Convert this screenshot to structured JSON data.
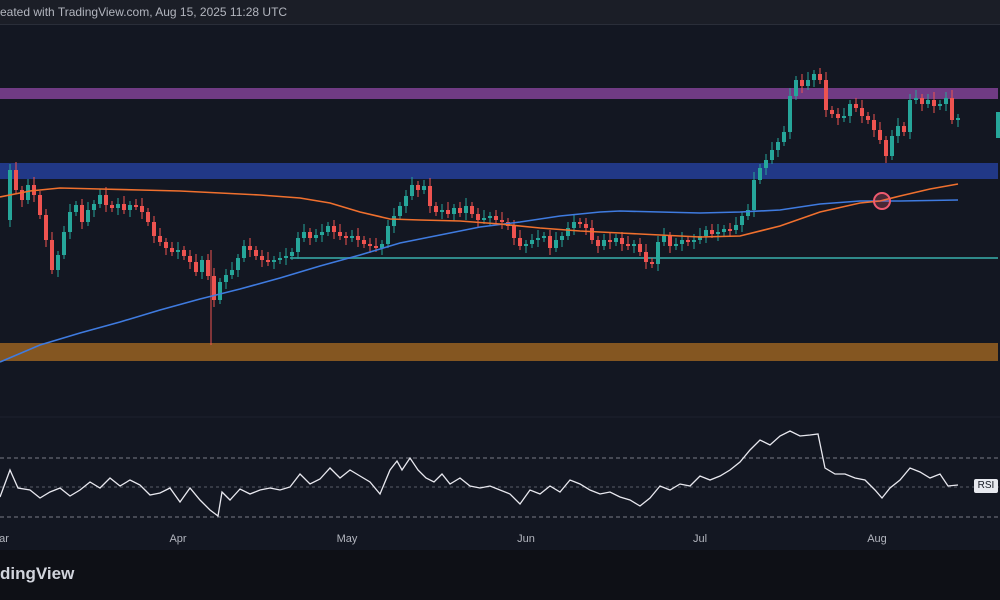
{
  "header": {
    "text": "eated with TradingView.com, Aug 15, 2025 11:28 UTC"
  },
  "footer": {
    "logo_text": "dingView"
  },
  "rsi_label": "RSI",
  "colors": {
    "background": "#131722",
    "bull": "#26a69a",
    "bear": "#ef5350",
    "zone_purple": "#7b3f8f",
    "zone_blue": "#223a8c",
    "zone_orange": "#8a5a22",
    "ma_orange": "#f0702e",
    "ma_blue": "#3f7be0",
    "support_teal": "#2f8a8a",
    "rsi_line": "#e8e8ef",
    "cross_marker": "#ef5a6f"
  },
  "chart_data": [
    {
      "type": "candlestick",
      "title": "",
      "x_tick_labels": [
        "ar",
        "Apr",
        "May",
        "Jun",
        "Jul",
        "Aug"
      ],
      "annotations": [
        {
          "kind": "zone",
          "name": "resistance-zone-purple",
          "color": "#7b3f8f"
        },
        {
          "kind": "zone",
          "name": "support-zone-blue",
          "color": "#223a8c"
        },
        {
          "kind": "zone",
          "name": "support-zone-orange",
          "color": "#8a5a22"
        },
        {
          "kind": "line",
          "name": "support-line-teal",
          "color": "#2f8a8a"
        },
        {
          "kind": "marker",
          "name": "golden-cross-circle",
          "color": "#ef5a6f"
        }
      ],
      "moving_averages": [
        {
          "name": "orange-ma",
          "color": "#f0702e"
        },
        {
          "name": "blue-ma",
          "color": "#3f7be0"
        }
      ]
    },
    {
      "type": "line",
      "indicator": "RSI",
      "levels": [
        "upper-dashed",
        "middle-dashed",
        "lower-dashed"
      ]
    }
  ]
}
